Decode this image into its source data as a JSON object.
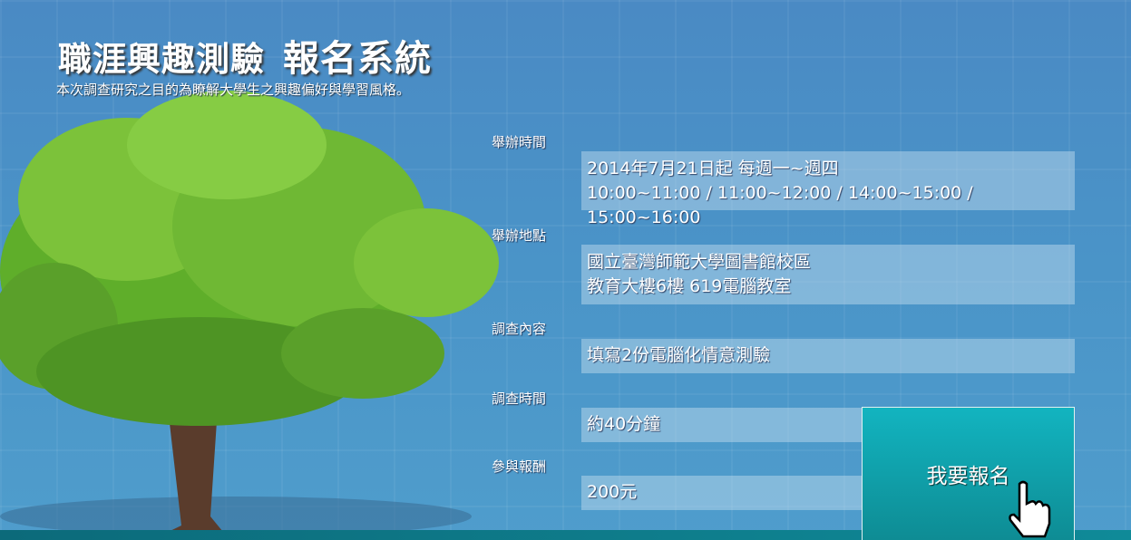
{
  "header": {
    "title_main": "職涯興趣測驗",
    "title_sub": "報名系統",
    "subtitle": "本次調查研究之目的為瞭解大學生之興趣偏好與學習風格。"
  },
  "info": [
    {
      "label": "舉辦時間",
      "lines": [
        "2014年7月21日起 每週一~週四",
        "10:00~11:00 / 11:00~12:00 / 14:00~15:00 / 15:00~16:00"
      ]
    },
    {
      "label": "舉辦地點",
      "lines": [
        "國立臺灣師範大學圖書館校區",
        "教育大樓6樓 619電腦教室"
      ]
    },
    {
      "label": "調查內容",
      "lines": [
        "填寫2份電腦化情意測驗"
      ]
    },
    {
      "label": "調查時間",
      "lines": [
        "約40分鐘"
      ]
    },
    {
      "label": "參與報酬",
      "lines": [
        "200元"
      ]
    }
  ],
  "cta": {
    "label": "我要報名"
  }
}
